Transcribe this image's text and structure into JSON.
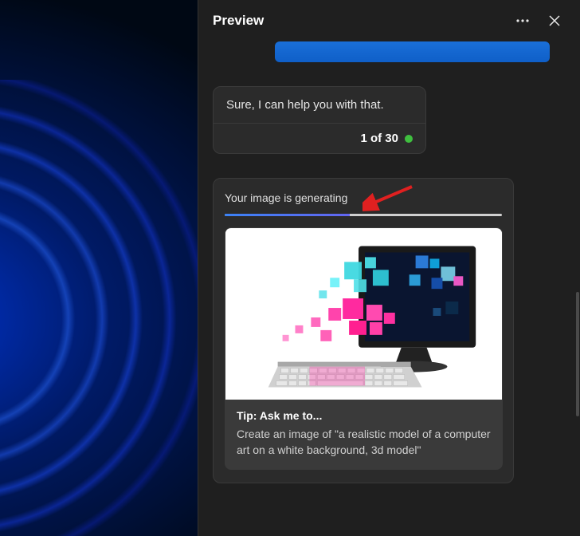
{
  "header": {
    "title": "Preview"
  },
  "blue_button_label": "",
  "chat": {
    "response_text": "Sure, I can help you with that.",
    "counter": "1 of 30"
  },
  "generation": {
    "status_text": "Your image is generating",
    "progress_pct": 45
  },
  "tip": {
    "title": "Tip: Ask me to...",
    "body": "Create an image of \"a realistic model of a computer art on a white background, 3d model\""
  },
  "colors": {
    "panel_bg": "#1f1f1f",
    "card_bg": "#2b2b2b",
    "blue": "#1a6fd8",
    "status_green": "#3fbf3f",
    "arrow_red": "#e02020"
  }
}
